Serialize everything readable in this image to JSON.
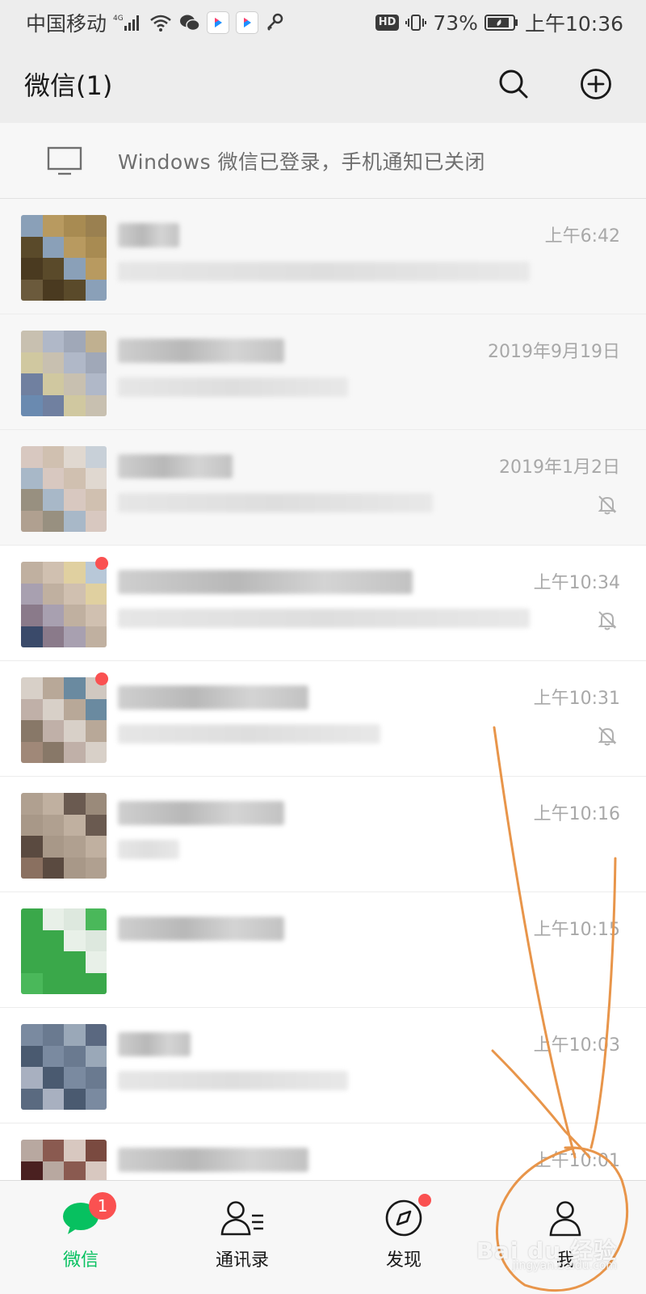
{
  "status_bar": {
    "carrier": "中国移动",
    "network": "4G",
    "battery": "73%",
    "time": "上午10:36",
    "hd_label": "HD",
    "app_icons": [
      "youku-icon",
      "youku-icon"
    ]
  },
  "header": {
    "title": "微信(1)",
    "icons": [
      "search-icon",
      "add-circle-icon"
    ]
  },
  "pc_notice": {
    "text": "Windows 微信已登录，手机通知已关闭",
    "icon": "monitor-icon"
  },
  "chats": [
    {
      "time": "上午6:42",
      "muted": false,
      "unread_dot": false
    },
    {
      "time": "2019年9月19日",
      "muted": false,
      "unread_dot": false
    },
    {
      "time": "2019年1月2日",
      "muted": true,
      "unread_dot": false
    },
    {
      "time": "上午10:34",
      "muted": true,
      "unread_dot": true
    },
    {
      "time": "上午10:31",
      "muted": true,
      "unread_dot": true
    },
    {
      "time": "上午10:16",
      "muted": false,
      "unread_dot": false
    },
    {
      "time": "上午10:15",
      "muted": false,
      "unread_dot": false
    },
    {
      "time": "上午10:03",
      "muted": false,
      "unread_dot": false
    },
    {
      "time": "上午10:01",
      "muted": false,
      "unread_dot": false
    }
  ],
  "bottom_nav": {
    "items": [
      {
        "label": "微信",
        "icon": "chat-bubble-icon",
        "active": true,
        "badge": "1"
      },
      {
        "label": "通讯录",
        "icon": "contacts-icon",
        "active": false
      },
      {
        "label": "发现",
        "icon": "compass-icon",
        "active": false,
        "dot": true
      },
      {
        "label": "我",
        "icon": "person-icon",
        "active": false
      }
    ]
  },
  "watermark": {
    "brand": "Bai du 经验",
    "url": "jingyan.baidu.com"
  },
  "colors": {
    "accent_green": "#07c160",
    "badge_red": "#fa5151",
    "annotation_orange": "#e8954a",
    "header_bg": "#ededed"
  }
}
